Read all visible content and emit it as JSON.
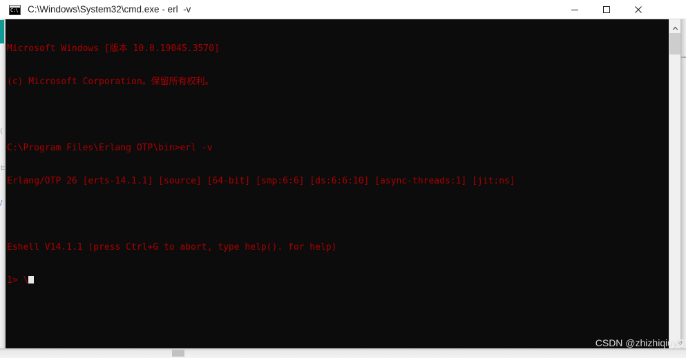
{
  "window": {
    "title": "C:\\Windows\\System32\\cmd.exe - erl  -v",
    "icon": "cmd-console-icon",
    "icon_text": "C:\\",
    "titlebar_bg": "#ffffff",
    "title_color": "#202020",
    "controls": {
      "minimize": "minimize-button",
      "maximize": "maximize-button",
      "close": "close-button"
    }
  },
  "console": {
    "background": "#0c0c0c",
    "foreground": "#aa0000",
    "cursor_color": "#e8e8e8",
    "lines": [
      "Microsoft Windows [版本 10.0.19045.3570]",
      "(c) Microsoft Corporation。保留所有权利。",
      "",
      "C:\\Program Files\\Erlang OTP\\bin>erl -v",
      "Erlang/OTP 26 [erts-14.1.1] [source] [64-bit] [smp:6:6] [ds:6:6:10] [async-threads:1] [jit:ns]",
      "",
      "Eshell V14.1.1 (press Ctrl+G to abort, type help(). for help)"
    ],
    "prompt": "1> \\",
    "prompt_cursor": "block"
  },
  "scrollbar": {
    "vertical": {
      "up_arrow": "scroll-up-arrow-icon",
      "track_color": "#f0f0f0",
      "thumb_color": "#cdcdcd"
    },
    "horizontal": {
      "thumb_color": "#c2c2c2"
    }
  },
  "watermark": {
    "text": "CSDN @zhizhiqiuy",
    "badge": "↺",
    "color": "#d8d8d8"
  },
  "background_artifacts": {
    "teal_accent": "#119a93",
    "glyph_1": "(",
    "glyph_2": "日",
    "glyph_3": "/"
  }
}
